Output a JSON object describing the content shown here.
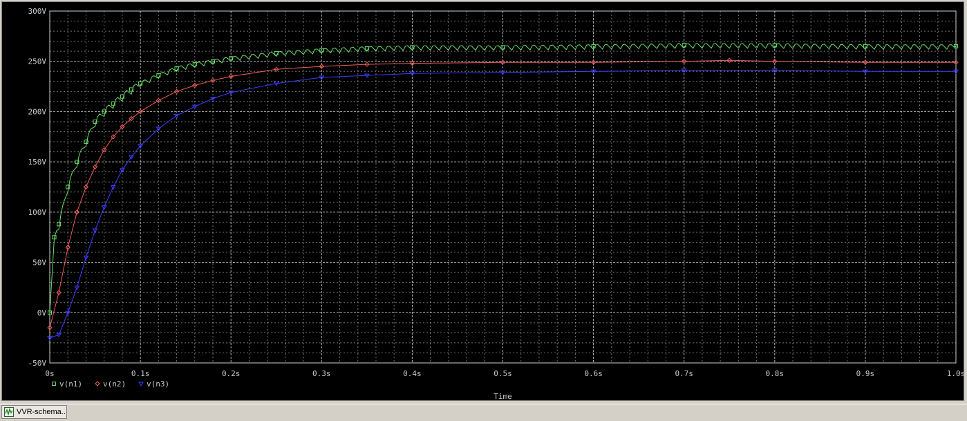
{
  "window": {
    "taskbar_item_label": "VVR-schema..."
  },
  "colors": {
    "background": "#000000",
    "grid": "#b4b4b4",
    "text": "#c8c8c8",
    "series": [
      "#66e066",
      "#f05a5a",
      "#3c3cff"
    ]
  },
  "icons": {
    "taskbar_icon": "waveform-app-icon"
  },
  "chart_data": {
    "type": "line",
    "title": "",
    "xlabel": "Time",
    "ylabel": "",
    "xlim": [
      0,
      1.0
    ],
    "ylim": [
      -50,
      300
    ],
    "grid": true,
    "legend_position": "bottom-left",
    "x_ticks": [
      0,
      0.1,
      0.2,
      0.3,
      0.4,
      0.5,
      0.6,
      0.7,
      0.8,
      0.9,
      1.0
    ],
    "x_tick_labels": [
      "0s",
      "0.1s",
      "0.2s",
      "0.3s",
      "0.4s",
      "0.5s",
      "0.6s",
      "0.7s",
      "0.8s",
      "0.9s",
      "1.0s"
    ],
    "y_ticks": [
      -50,
      0,
      50,
      100,
      150,
      200,
      250,
      300
    ],
    "y_tick_labels": [
      "-50V",
      "0V",
      "50V",
      "100V",
      "150V",
      "200V",
      "250V",
      "300V"
    ],
    "series": [
      {
        "name": "v(n1)",
        "marker": "square",
        "x": [
          0,
          0.005,
          0.01,
          0.02,
          0.03,
          0.04,
          0.05,
          0.06,
          0.07,
          0.08,
          0.09,
          0.1,
          0.12,
          0.14,
          0.16,
          0.18,
          0.2,
          0.25,
          0.3,
          0.35,
          0.4,
          0.5,
          0.6,
          0.7,
          0.8,
          0.9,
          1.0
        ],
        "y": [
          0,
          75,
          88,
          125,
          150,
          170,
          190,
          200,
          208,
          215,
          222,
          228,
          236,
          243,
          247,
          250,
          253,
          258,
          261,
          263,
          264,
          264,
          265,
          266,
          266,
          265,
          265
        ],
        "ripple": 6
      },
      {
        "name": "v(n2)",
        "marker": "diamond",
        "x": [
          0,
          0.01,
          0.02,
          0.03,
          0.04,
          0.05,
          0.06,
          0.07,
          0.08,
          0.09,
          0.1,
          0.12,
          0.14,
          0.16,
          0.18,
          0.2,
          0.25,
          0.3,
          0.35,
          0.4,
          0.5,
          0.6,
          0.7,
          0.75,
          0.8,
          0.9,
          1.0
        ],
        "y": [
          -15,
          20,
          65,
          100,
          125,
          145,
          162,
          175,
          185,
          193,
          200,
          211,
          220,
          226,
          231,
          235,
          242,
          245,
          247,
          248,
          249,
          249,
          250,
          251,
          250,
          249,
          249
        ]
      },
      {
        "name": "v(n3)",
        "marker": "triangle-down",
        "x": [
          0,
          0.01,
          0.02,
          0.03,
          0.04,
          0.05,
          0.06,
          0.07,
          0.08,
          0.09,
          0.1,
          0.12,
          0.14,
          0.16,
          0.18,
          0.2,
          0.25,
          0.3,
          0.35,
          0.4,
          0.5,
          0.6,
          0.7,
          0.8,
          0.9,
          1.0
        ],
        "y": [
          -25,
          -22,
          0,
          25,
          55,
          82,
          105,
          125,
          142,
          155,
          166,
          183,
          196,
          205,
          213,
          219,
          228,
          234,
          236,
          238,
          239,
          240,
          241,
          241,
          240,
          240
        ]
      }
    ]
  }
}
